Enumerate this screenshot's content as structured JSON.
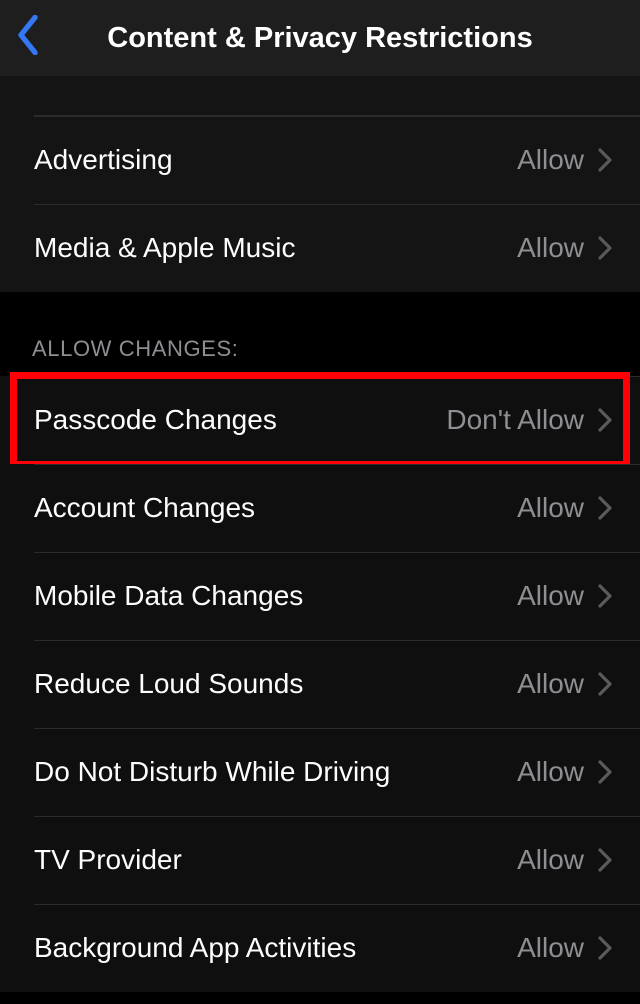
{
  "header": {
    "title": "Content & Privacy Restrictions"
  },
  "group_top": {
    "rows": [
      {
        "label": "",
        "value": ""
      },
      {
        "label": "Advertising",
        "value": "Allow"
      },
      {
        "label": "Media & Apple Music",
        "value": "Allow"
      }
    ]
  },
  "group_allow_changes": {
    "header": "ALLOW CHANGES:",
    "rows": [
      {
        "label": "Passcode Changes",
        "value": "Don't Allow",
        "highlight": true
      },
      {
        "label": "Account Changes",
        "value": "Allow"
      },
      {
        "label": "Mobile Data Changes",
        "value": "Allow"
      },
      {
        "label": "Reduce Loud Sounds",
        "value": "Allow"
      },
      {
        "label": "Do Not Disturb While Driving",
        "value": "Allow"
      },
      {
        "label": "TV Provider",
        "value": "Allow"
      },
      {
        "label": "Background App Activities",
        "value": "Allow"
      }
    ]
  }
}
